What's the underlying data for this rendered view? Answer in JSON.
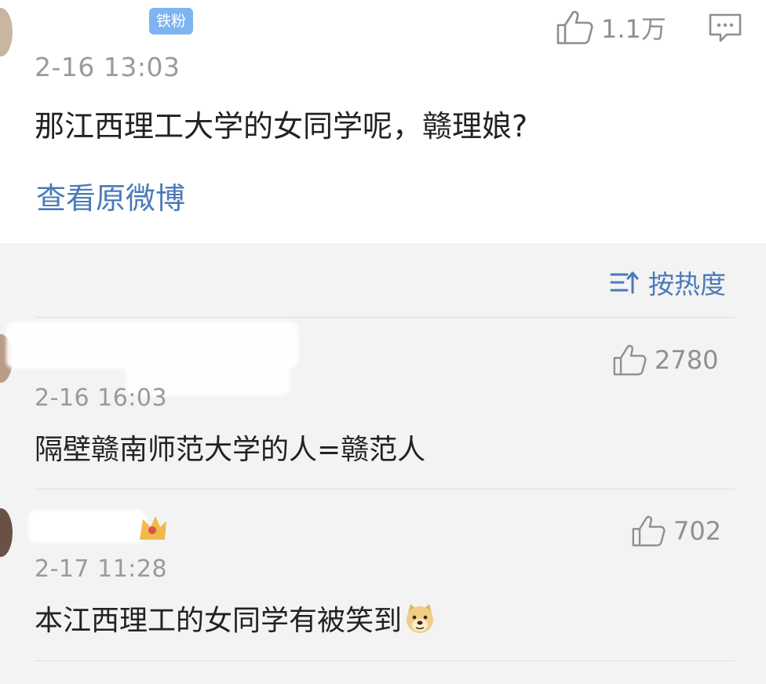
{
  "original": {
    "badge": "铁粉",
    "timestamp": "2-16 13:03",
    "content": "那江西理工大学的女同学呢，赣理娘?",
    "likes": "1.1万",
    "view_original": "查看原微博"
  },
  "sort": {
    "label": "按热度"
  },
  "comments": [
    {
      "timestamp": "2-16 16:03",
      "content": "隔壁赣南师范大学的人=赣范人",
      "likes": "2780"
    },
    {
      "timestamp": "2-17 11:28",
      "content": "本江西理工的女同学有被笑到",
      "likes": "702"
    }
  ],
  "colors": {
    "accent": "#4b7ab8",
    "badge": "#7fb4f2",
    "muted": "#9a9a9a"
  },
  "icons": [
    "thumbs-up-icon",
    "comment-icon",
    "sort-icon",
    "doge-emoji-icon"
  ]
}
